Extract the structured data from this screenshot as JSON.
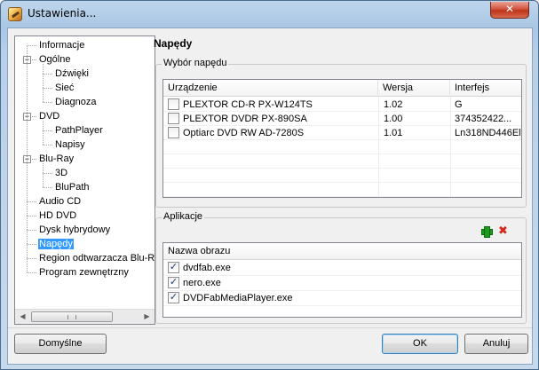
{
  "window": {
    "title": "Ustawienia...",
    "close_glyph": "✕",
    "app_icon": "dvdfab-settings-icon"
  },
  "tree": {
    "items": [
      {
        "label": "Informacje",
        "level": 0,
        "expander": ""
      },
      {
        "label": "Ogólne",
        "level": 0,
        "expander": "−"
      },
      {
        "label": "Dźwięki",
        "level": 1,
        "expander": ""
      },
      {
        "label": "Sieć",
        "level": 1,
        "expander": ""
      },
      {
        "label": "Diagnoza",
        "level": 1,
        "expander": ""
      },
      {
        "label": "DVD",
        "level": 0,
        "expander": "−"
      },
      {
        "label": "PathPlayer",
        "level": 1,
        "expander": ""
      },
      {
        "label": "Napisy",
        "level": 1,
        "expander": ""
      },
      {
        "label": "Blu-Ray",
        "level": 0,
        "expander": "−"
      },
      {
        "label": "3D",
        "level": 1,
        "expander": ""
      },
      {
        "label": "BluPath",
        "level": 1,
        "expander": ""
      },
      {
        "label": "Audio CD",
        "level": 0,
        "expander": ""
      },
      {
        "label": "HD DVD",
        "level": 0,
        "expander": ""
      },
      {
        "label": "Dysk hybrydowy",
        "level": 0,
        "expander": ""
      },
      {
        "label": "Napędy",
        "level": 0,
        "expander": "",
        "selected": true
      },
      {
        "label": "Region odtwarzacza Blu-Ray",
        "level": 0,
        "expander": ""
      },
      {
        "label": "Program zewnętrzny",
        "level": 0,
        "expander": ""
      }
    ],
    "scroll_left": "◀",
    "scroll_right": "▶"
  },
  "section": {
    "title": "Napędy"
  },
  "drives": {
    "group_title": "Wybór napędu",
    "columns": [
      "Urządzenie",
      "Wersja",
      "Interfejs"
    ],
    "rows": [
      {
        "checked": false,
        "device": "PLEXTOR CD-R   PX-W124TS",
        "version": "1.02",
        "interface": "G"
      },
      {
        "checked": false,
        "device": "PLEXTOR DVDR   PX-890SA",
        "version": "1.00",
        "interface": "374352422..."
      },
      {
        "checked": false,
        "device": "Optiarc DVD RW AD-7280S",
        "version": "1.01",
        "interface": "Ln318ND446El"
      }
    ]
  },
  "apps": {
    "group_title": "Aplikacje",
    "add_icon": "add-icon",
    "remove_icon": "remove-icon",
    "remove_glyph": "✖",
    "column": "Nazwa obrazu",
    "rows": [
      {
        "checked": true,
        "name": "dvdfab.exe"
      },
      {
        "checked": true,
        "name": "nero.exe"
      },
      {
        "checked": true,
        "name": "DVDFabMediaPlayer.exe"
      }
    ]
  },
  "buttons": {
    "defaults": "Domyślne",
    "ok": "OK",
    "cancel": "Anuluj"
  },
  "check_glyph": "✓"
}
